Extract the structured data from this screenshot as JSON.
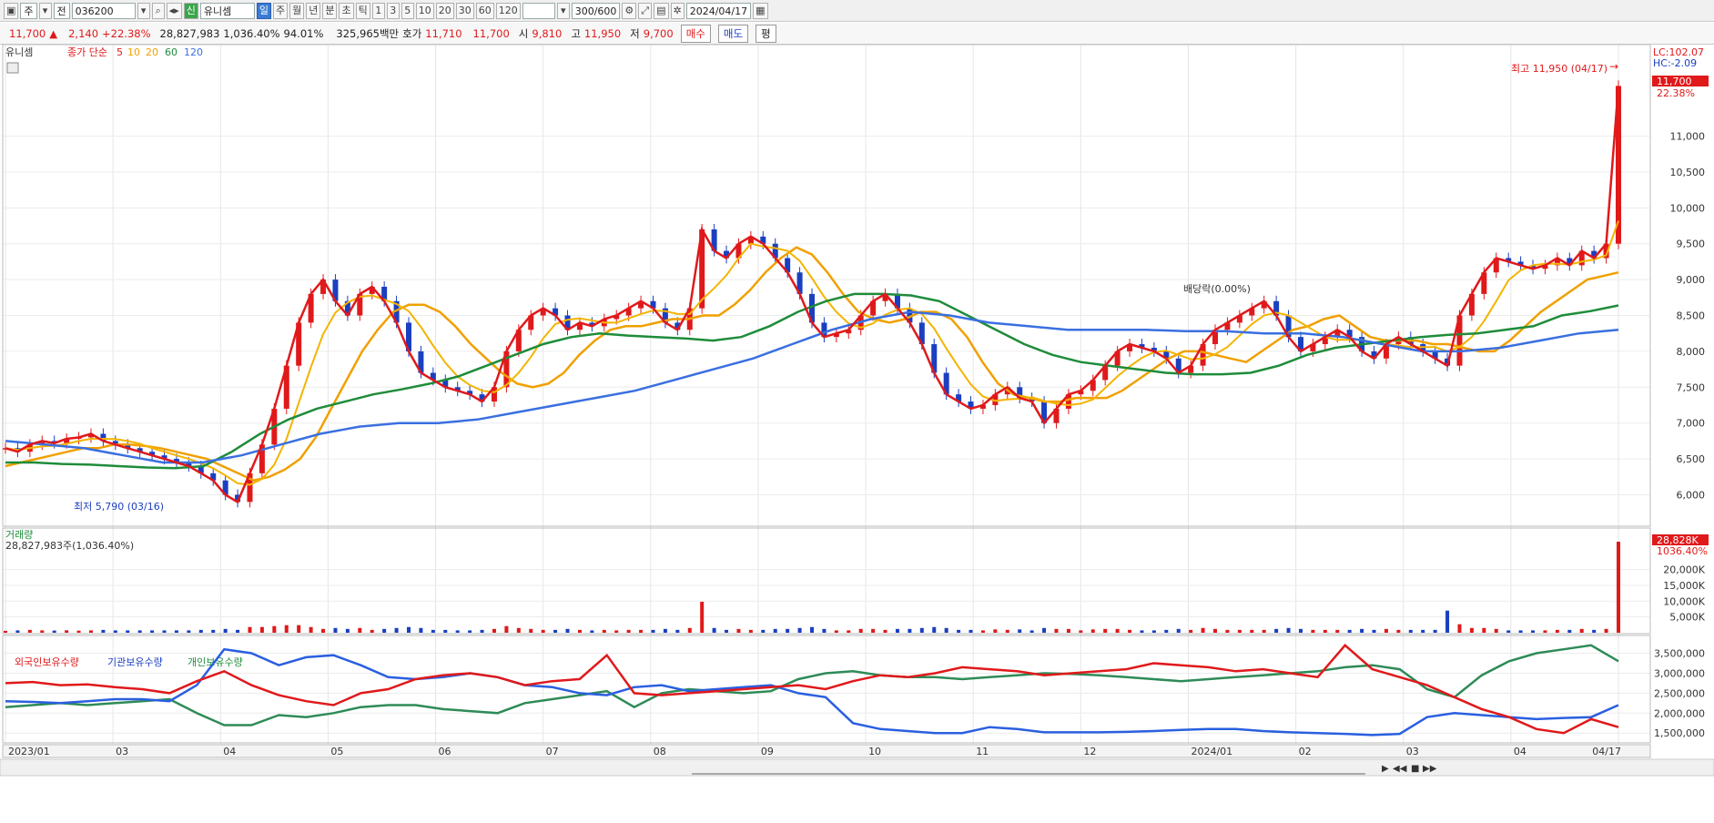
{
  "toolbar": {
    "market": "주",
    "prefix": "전",
    "code": "036200",
    "stock_badge": "신",
    "stock_name": "유니셈",
    "periods": [
      "일",
      "주",
      "월",
      "년",
      "분",
      "초",
      "틱"
    ],
    "minute_options": [
      "1",
      "3",
      "5",
      "10",
      "20",
      "30",
      "60",
      "120"
    ],
    "count": "300/600",
    "date": "2024/04/17"
  },
  "infobar": {
    "price": "11,700",
    "arrow": "▲",
    "change": "2,140",
    "change_pct": "+22.38%",
    "volume": "28,827,983",
    "vol_ratio": "1,036.40%",
    "turnover": "94.01%",
    "amount": "325,965백만",
    "bid_label": "호가",
    "bid1": "11,710",
    "bid2": "11,700",
    "open_label": "시",
    "open": "9,810",
    "high_label": "고",
    "high": "11,950",
    "low_label": "저",
    "low": "9,700",
    "buy_label": "매수",
    "sell_label": "매도",
    "eval_label": "평"
  },
  "colors": {
    "up": "#e0191b",
    "down": "#1a3fc0",
    "ma5": "#e0191b",
    "ma10": "#f0a000",
    "ma20": "#f0a000",
    "ma60": "#1e8c3a",
    "ma120": "#3a6fe0"
  },
  "chart_data": [
    {
      "type": "line",
      "name_label": "유니셈",
      "legend_label": "종가 단순",
      "legend": [
        "5",
        "10",
        "20",
        "60",
        "120"
      ],
      "ylim": [
        5600,
        12200
      ],
      "yticks": [
        "6,000",
        "6,500",
        "7,000",
        "7,500",
        "8,000",
        "8,500",
        "9,000",
        "9,500",
        "10,000",
        "10,500",
        "11,000"
      ],
      "x_tick_labels": [
        "2023/01",
        "03",
        "04",
        "05",
        "06",
        "07",
        "08",
        "09",
        "10",
        "11",
        "12",
        "2024/01",
        "02",
        "03",
        "04",
        "04/17"
      ],
      "lc_label": "LC:102.07",
      "hc_label": "HC:-2.09",
      "price_badge": "11,700",
      "pct_badge": "22.38%",
      "high_annotation": "최고 11,950 (04/17)",
      "low_annotation": "최저 5,790 (03/16)",
      "dividend_annotation": "배당락(0.00%)",
      "closes": [
        6650,
        6600,
        6700,
        6750,
        6720,
        6780,
        6800,
        6850,
        6750,
        6700,
        6650,
        6600,
        6550,
        6500,
        6450,
        6400,
        6300,
        6200,
        6000,
        5900,
        6300,
        6700,
        7200,
        7800,
        8400,
        8800,
        9000,
        8700,
        8500,
        8800,
        8900,
        8700,
        8400,
        8000,
        7700,
        7600,
        7500,
        7450,
        7400,
        7300,
        7500,
        8000,
        8300,
        8500,
        8600,
        8500,
        8300,
        8400,
        8350,
        8450,
        8500,
        8600,
        8700,
        8600,
        8400,
        8300,
        8600,
        9700,
        9400,
        9300,
        9500,
        9600,
        9500,
        9300,
        9100,
        8800,
        8400,
        8200,
        8250,
        8300,
        8500,
        8700,
        8800,
        8600,
        8400,
        8100,
        7700,
        7400,
        7300,
        7200,
        7250,
        7400,
        7500,
        7350,
        7300,
        7000,
        7200,
        7400,
        7450,
        7600,
        7800,
        8000,
        8100,
        8050,
        8000,
        7900,
        7700,
        7800,
        8100,
        8300,
        8400,
        8500,
        8600,
        8700,
        8500,
        8200,
        8000,
        8100,
        8200,
        8300,
        8200,
        8000,
        7900,
        8100,
        8200,
        8100,
        8000,
        7900,
        7800,
        8500,
        8800,
        9100,
        9300,
        9250,
        9200,
        9150,
        9200,
        9300,
        9200,
        9400,
        9300,
        9500,
        11700
      ],
      "ma20": [
        6400,
        6450,
        6500,
        6550,
        6600,
        6650,
        6650,
        6700,
        6700,
        6680,
        6650,
        6600,
        6550,
        6500,
        6400,
        6300,
        6200,
        6250,
        6350,
        6500,
        6800,
        7200,
        7600,
        8000,
        8300,
        8550,
        8650,
        8650,
        8550,
        8350,
        8100,
        7900,
        7700,
        7550,
        7500,
        7550,
        7700,
        7950,
        8150,
        8300,
        8350,
        8350,
        8400,
        8450,
        8450,
        8500,
        8500,
        8650,
        8850,
        9100,
        9300,
        9450,
        9350,
        9100,
        8800,
        8550,
        8450,
        8400,
        8450,
        8550,
        8550,
        8450,
        8200,
        7850,
        7550,
        7400,
        7350,
        7300,
        7300,
        7350,
        7350,
        7350,
        7450,
        7600,
        7750,
        7900,
        8000,
        8000,
        7950,
        7900,
        7850,
        8000,
        8150,
        8300,
        8350,
        8450,
        8500,
        8350,
        8200,
        8150,
        8150,
        8150,
        8100,
        8100,
        8050,
        8000,
        8000,
        8150,
        8350,
        8550,
        8700,
        8850,
        9000,
        9050,
        9100
      ],
      "ma60": [
        6450,
        6450,
        6430,
        6420,
        6400,
        6380,
        6370,
        6400,
        6600,
        6850,
        7050,
        7200,
        7300,
        7400,
        7470,
        7550,
        7650,
        7800,
        7950,
        8100,
        8200,
        8250,
        8220,
        8200,
        8180,
        8150,
        8200,
        8350,
        8550,
        8700,
        8800,
        8800,
        8780,
        8700,
        8500,
        8300,
        8100,
        7950,
        7850,
        7800,
        7750,
        7700,
        7680,
        7680,
        7700,
        7800,
        7950,
        8050,
        8100,
        8150,
        8200,
        8230,
        8250,
        8300,
        8350,
        8500,
        8560,
        8640
      ],
      "ma120": [
        6750,
        6700,
        6650,
        6550,
        6450,
        6450,
        6550,
        6700,
        6850,
        6950,
        7000,
        7000,
        7050,
        7150,
        7250,
        7350,
        7450,
        7600,
        7750,
        7900,
        8100,
        8300,
        8450,
        8550,
        8500,
        8400,
        8350,
        8300,
        8300,
        8300,
        8280,
        8280,
        8250,
        8250,
        8200,
        8100,
        8000,
        8000,
        8050,
        8150,
        8250,
        8300
      ]
    },
    {
      "type": "bar",
      "name_label": "거래량",
      "summary": "28,827,983주(1,036.40%)",
      "yticks": [
        "5,000K",
        "10,000K",
        "15,000K",
        "20,000K"
      ],
      "ylim": [
        0,
        28828
      ],
      "last_badge": "28,828K",
      "last_pct_badge": "1036.40%",
      "spikes": [
        {
          "label": "07",
          "value": 9800
        },
        {
          "label": "03",
          "value": 7000
        },
        {
          "label": "04/17",
          "value": 28828
        }
      ]
    },
    {
      "type": "line",
      "series_names": [
        "외국인보유수량",
        "기관보유수량",
        "개인보유수량"
      ],
      "ylim": [
        1300000,
        3900000
      ],
      "yticks": [
        "1,500,000",
        "2,000,000",
        "2,500,000",
        "3,000,000",
        "3,500,000"
      ],
      "foreign": [
        2750000,
        2780000,
        2700000,
        2720000,
        2650000,
        2600000,
        2500000,
        2800000,
        3050000,
        2700000,
        2450000,
        2300000,
        2200000,
        2500000,
        2600000,
        2850000,
        2950000,
        3000000,
        2900000,
        2700000,
        2800000,
        2850000,
        3450000,
        2500000,
        2450000,
        2500000,
        2550000,
        2600000,
        2650000,
        2700000,
        2600000,
        2800000,
        2950000,
        2900000,
        3000000,
        3150000,
        3100000,
        3050000,
        2950000,
        3000000,
        3050000,
        3100000,
        3250000,
        3200000,
        3150000,
        3050000,
        3100000,
        3000000,
        2900000,
        3700000,
        3100000,
        2900000,
        2700000,
        2400000,
        2100000,
        1900000,
        1600000,
        1500000,
        1850000,
        1650000
      ],
      "institution": [
        2300000,
        2280000,
        2250000,
        2300000,
        2350000,
        2350000,
        2300000,
        2700000,
        3600000,
        3500000,
        3200000,
        3400000,
        3450000,
        3200000,
        2900000,
        2850000,
        2900000,
        3000000,
        2900000,
        2700000,
        2650000,
        2500000,
        2450000,
        2650000,
        2700000,
        2550000,
        2600000,
        2650000,
        2700000,
        2500000,
        2400000,
        1750000,
        1600000,
        1550000,
        1500000,
        1500000,
        1650000,
        1600000,
        1520000,
        1520000,
        1520000,
        1530000,
        1550000,
        1580000,
        1600000,
        1600000,
        1550000,
        1520000,
        1500000,
        1480000,
        1450000,
        1480000,
        1900000,
        2000000,
        1950000,
        1900000,
        1850000,
        1880000,
        1900000,
        2200000
      ],
      "individual": [
        2150000,
        2200000,
        2250000,
        2200000,
        2250000,
        2300000,
        2350000,
        2000000,
        1700000,
        1700000,
        1950000,
        1900000,
        2000000,
        2150000,
        2200000,
        2200000,
        2100000,
        2050000,
        2000000,
        2250000,
        2350000,
        2450000,
        2550000,
        2150000,
        2500000,
        2600000,
        2550000,
        2500000,
        2550000,
        2850000,
        3000000,
        3050000,
        2950000,
        2900000,
        2900000,
        2850000,
        2900000,
        2950000,
        3000000,
        2980000,
        2950000,
        2900000,
        2850000,
        2800000,
        2850000,
        2900000,
        2950000,
        3000000,
        3050000,
        3150000,
        3200000,
        3100000,
        2600000,
        2400000,
        2950000,
        3300000,
        3500000,
        3600000,
        3700000,
        3300000
      ]
    }
  ],
  "scrollbar": {
    "controls": [
      "▶",
      "◀◀",
      "■",
      "▶▶"
    ]
  }
}
